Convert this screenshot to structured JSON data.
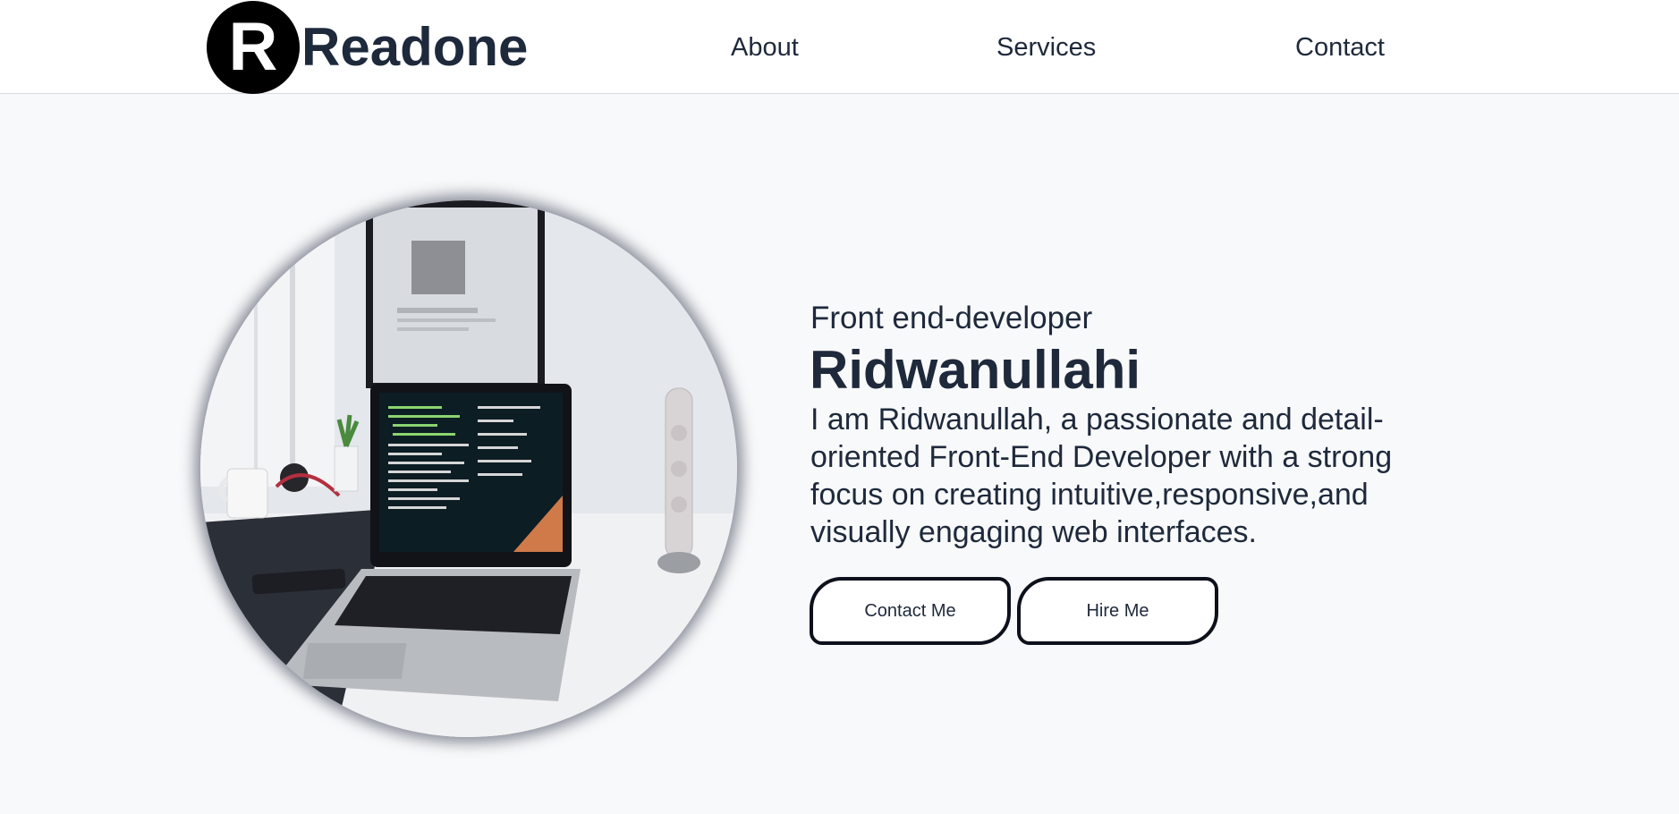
{
  "header": {
    "logo_letter": "R",
    "logo_text": "Readone",
    "nav": [
      {
        "label": "About"
      },
      {
        "label": "Services"
      },
      {
        "label": "Contact"
      }
    ]
  },
  "hero": {
    "subtitle": "Front end-developer",
    "name": "Ridwanullahi",
    "bio": "I am Ridwanullah, a passionate and detail-oriented Front-End Developer with a strong focus on creating intuitive,responsive,and visually engaging web interfaces.",
    "buttons": {
      "contact_label": "Contact Me",
      "hire_label": "Hire Me"
    },
    "image_icon": "laptop-desk-photo"
  },
  "colors": {
    "text": "#1e293b",
    "background": "#f8f9fa",
    "navbar": "#ffffff",
    "logo_circle": "#000000",
    "button_border": "#0d111c"
  }
}
